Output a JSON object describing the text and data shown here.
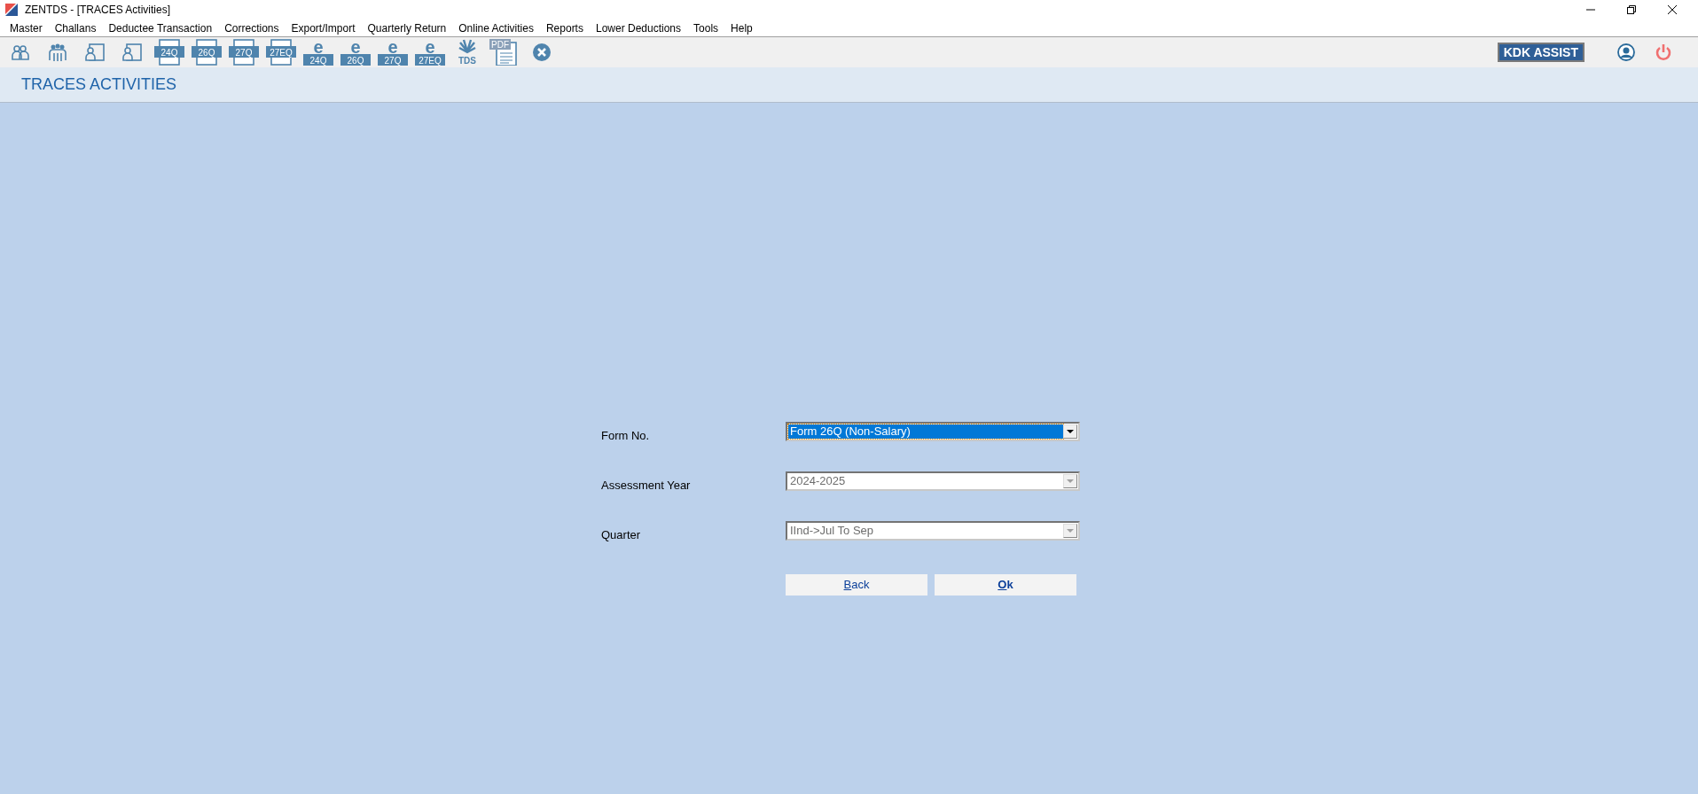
{
  "window": {
    "title": "ZENTDS - [TRACES Activities]"
  },
  "menu": [
    "Master",
    "Challans",
    "Deductee Transaction",
    "Corrections",
    "Export/Import",
    "Quarterly Return",
    "Online Activities",
    "Reports",
    "Lower Deductions",
    "Tools",
    "Help"
  ],
  "toolbar": [
    {
      "kind": "person-pair"
    },
    {
      "kind": "people-group"
    },
    {
      "kind": "person-card"
    },
    {
      "kind": "person-card"
    },
    {
      "kind": "form",
      "label": "24Q"
    },
    {
      "kind": "form",
      "label": "26Q"
    },
    {
      "kind": "form",
      "label": "27Q"
    },
    {
      "kind": "form",
      "label": "27EQ"
    },
    {
      "kind": "eform",
      "prefix": "e",
      "label": "24Q"
    },
    {
      "kind": "eform",
      "prefix": "e",
      "label": "26Q"
    },
    {
      "kind": "eform",
      "prefix": "e",
      "label": "27Q"
    },
    {
      "kind": "eform",
      "prefix": "e",
      "label": "27EQ"
    },
    {
      "kind": "tds",
      "label": "TDS"
    },
    {
      "kind": "pdf",
      "label": "PDF"
    },
    {
      "kind": "close"
    }
  ],
  "assist_button": "KDK ASSIST",
  "page_title": "TRACES ACTIVITIES",
  "fields": [
    {
      "label": "Form No.",
      "value": "Form 26Q (Non-Salary)",
      "disabled": false,
      "focused": true
    },
    {
      "label": "Assessment Year",
      "value": "2024-2025",
      "disabled": true,
      "focused": false
    },
    {
      "label": "Quarter",
      "value": "IInd->Jul To Sep",
      "disabled": true,
      "focused": false
    }
  ],
  "buttons": [
    {
      "access_key": "B",
      "label_rest": "ack",
      "bold": false
    },
    {
      "access_key": "O",
      "label_rest": "k",
      "bold": true
    }
  ]
}
